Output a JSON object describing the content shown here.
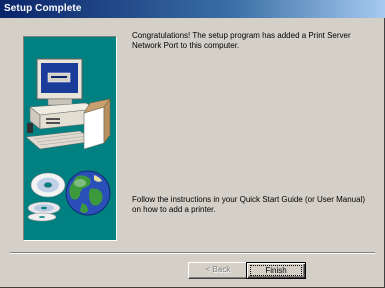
{
  "window": {
    "title": "Setup Complete"
  },
  "content": {
    "message_1": "Congratulations! The setup program has added a Print Server Network Port to this computer.",
    "message_2": "Follow the instructions in your Quick Start Guide (or User Manual) on how to add a printer."
  },
  "buttons": {
    "back": "< Back",
    "finish": "Finish"
  },
  "art": {
    "icons": [
      "computer-icon",
      "cd-discs-icon",
      "globe-icon"
    ]
  },
  "colors": {
    "title_bar": "#0a246a",
    "art_panel": "#008080",
    "dialog": "#d4d0c8"
  }
}
